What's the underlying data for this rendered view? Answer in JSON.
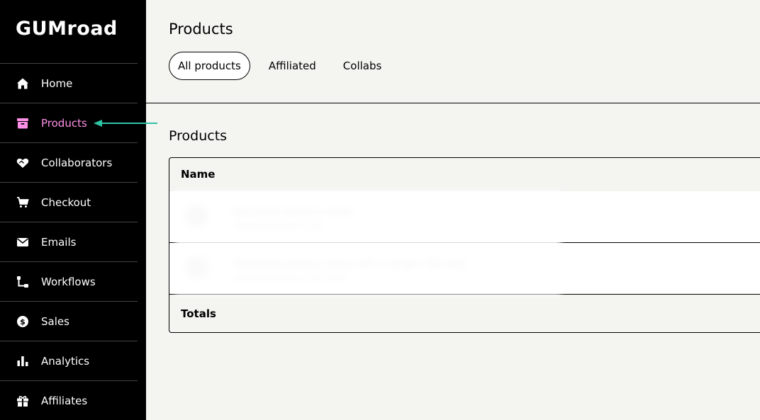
{
  "app": {
    "logo_text": "GUMroad"
  },
  "sidebar": {
    "items": [
      {
        "label": "Home",
        "icon": "home-icon"
      },
      {
        "label": "Products",
        "icon": "archive-box-icon",
        "active": true
      },
      {
        "label": "Collaborators",
        "icon": "handshake-heart-icon"
      },
      {
        "label": "Checkout",
        "icon": "cart-icon"
      },
      {
        "label": "Emails",
        "icon": "envelope-icon"
      },
      {
        "label": "Workflows",
        "icon": "workflow-icon"
      },
      {
        "label": "Sales",
        "icon": "dollar-circle-icon"
      },
      {
        "label": "Analytics",
        "icon": "bar-chart-icon"
      },
      {
        "label": "Affiliates",
        "icon": "gift-icon"
      }
    ],
    "active_color": "#ff90e8"
  },
  "main": {
    "title": "Products",
    "tabs": [
      {
        "label": "All products",
        "active": true
      },
      {
        "label": "Affiliated"
      },
      {
        "label": "Collabs"
      }
    ],
    "section_title": "Products",
    "table": {
      "header": {
        "name": "Name"
      },
      "rows": [
        {
          "name": "Redacted product name",
          "sub": "redacted product link"
        },
        {
          "name": "Redacted product name with a longer title text",
          "sub": "redacted product link here"
        }
      ],
      "footer": {
        "label": "Totals"
      }
    }
  },
  "annotation": {
    "arrow_color": "#2ec4a6"
  }
}
